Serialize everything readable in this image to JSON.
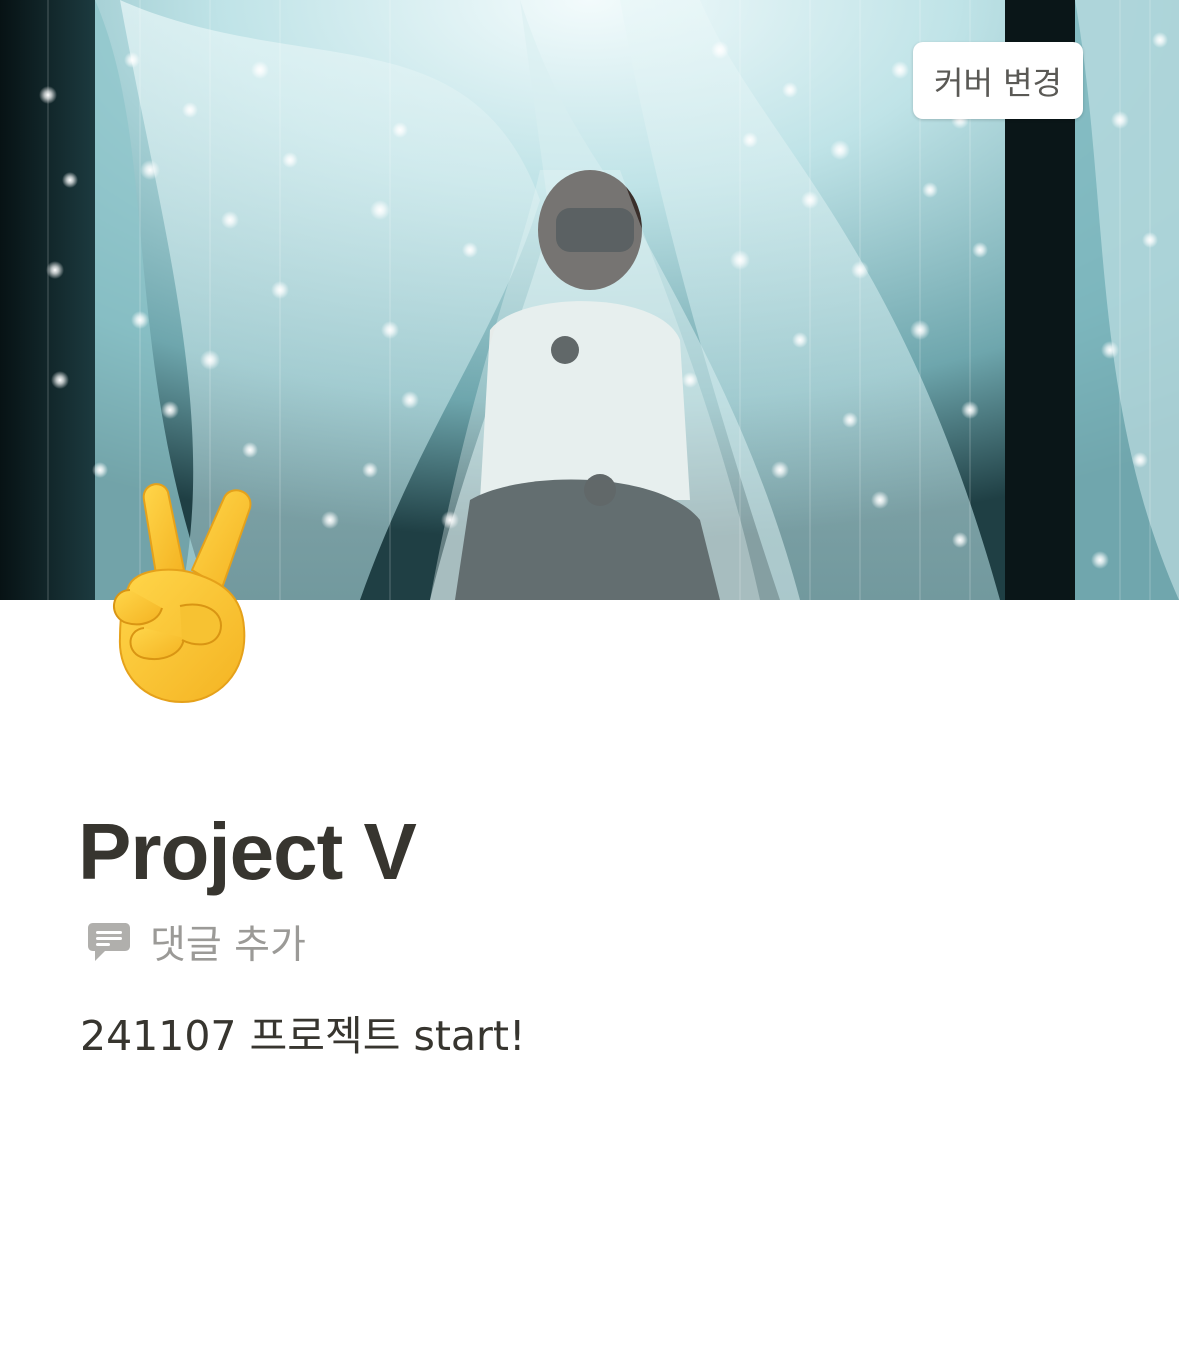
{
  "cover": {
    "image_alt": "person wearing VR headset sitting under sheer curtains with string lights",
    "change_button_label": "커버 변경"
  },
  "page_icon": {
    "icon": "victory-hand-emoji"
  },
  "page": {
    "title": "Project V",
    "add_comment_label": "댓글 추가",
    "body_text": "241107 프로젝트 start!"
  },
  "colors": {
    "text_primary": "#37352f",
    "text_muted": "#9b9a97",
    "button_text": "#5a5955",
    "cover_tint": "#9fd2d8"
  }
}
